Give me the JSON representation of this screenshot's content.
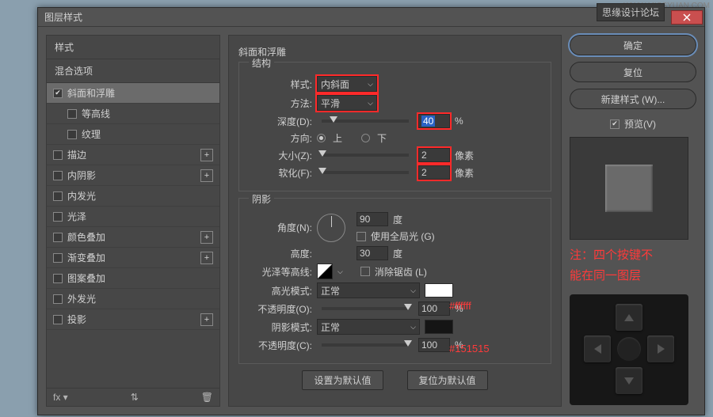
{
  "brand": "思缘设计论坛",
  "watermark": "WWW.MISSYUAN.COM",
  "window": {
    "title": "图层样式"
  },
  "left": {
    "styles_header": "样式",
    "blend_header": "混合选项",
    "items": [
      {
        "label": "斜面和浮雕",
        "checked": true,
        "selected": true,
        "plus": false
      },
      {
        "label": "等高线",
        "checked": false,
        "selected": false,
        "plus": false,
        "sub": true
      },
      {
        "label": "纹理",
        "checked": false,
        "selected": false,
        "plus": false,
        "sub": true
      },
      {
        "label": "描边",
        "checked": false,
        "plus": true
      },
      {
        "label": "内阴影",
        "checked": false,
        "plus": true
      },
      {
        "label": "内发光",
        "checked": false,
        "plus": false
      },
      {
        "label": "光泽",
        "checked": false,
        "plus": false
      },
      {
        "label": "颜色叠加",
        "checked": false,
        "plus": true
      },
      {
        "label": "渐变叠加",
        "checked": false,
        "plus": true
      },
      {
        "label": "图案叠加",
        "checked": false,
        "plus": false
      },
      {
        "label": "外发光",
        "checked": false,
        "plus": false
      },
      {
        "label": "投影",
        "checked": false,
        "plus": true
      }
    ]
  },
  "mid": {
    "title": "斜面和浮雕",
    "structure": {
      "legend": "结构",
      "style_lbl": "样式:",
      "style_val": "内斜面",
      "method_lbl": "方法:",
      "method_val": "平滑",
      "depth_lbl": "深度(D):",
      "depth_val": "40",
      "depth_unit": "%",
      "dir_lbl": "方向:",
      "dir_up": "上",
      "dir_down": "下",
      "size_lbl": "大小(Z):",
      "size_val": "2",
      "size_unit": "像素",
      "soften_lbl": "软化(F):",
      "soften_val": "2",
      "soften_unit": "像素"
    },
    "shadow": {
      "legend": "阴影",
      "angle_lbl": "角度(N):",
      "angle_val": "90",
      "angle_unit": "度",
      "global_lbl": "使用全局光 (G)",
      "alt_lbl": "高度:",
      "alt_val": "30",
      "alt_unit": "度",
      "gloss_lbl": "光泽等高线:",
      "aa_lbl": "消除锯齿 (L)",
      "hl_mode_lbl": "高光模式:",
      "hl_mode_val": "正常",
      "hl_op_lbl": "不透明度(O):",
      "hl_op_val": "100",
      "pct": "%",
      "sh_mode_lbl": "阴影模式:",
      "sh_mode_val": "正常",
      "sh_op_lbl": "不透明度(C):",
      "sh_op_val": "100"
    },
    "btn_default": "设置为默认值",
    "btn_reset": "复位为默认值",
    "annot_white": "#ffffff",
    "annot_dark": "#151515"
  },
  "right": {
    "ok": "确定",
    "reset": "复位",
    "new_style": "新建样式 (W)...",
    "preview": "预览(V)",
    "note_l1": "注：四个按键不",
    "note_l2": "能在同一图层"
  }
}
